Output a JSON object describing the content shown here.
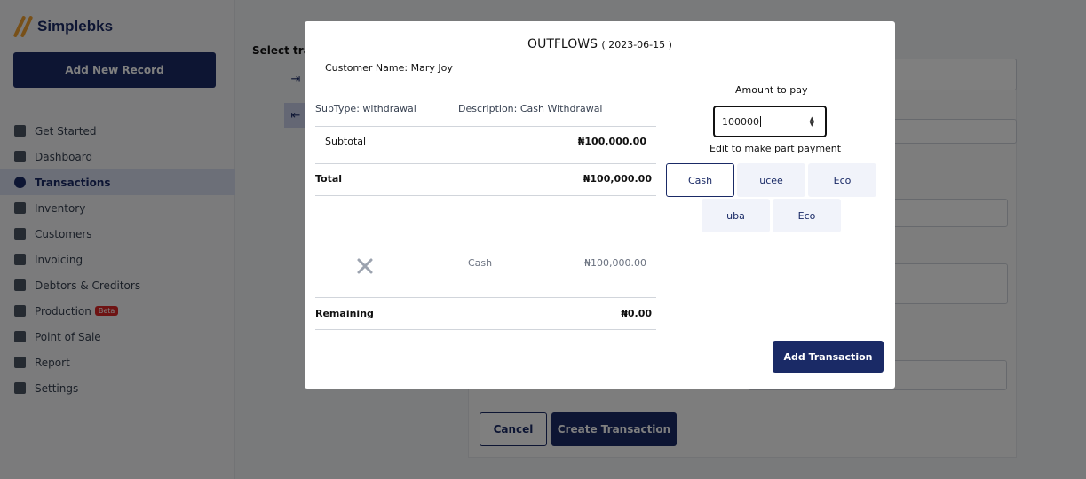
{
  "brand": {
    "name": "Simplebks"
  },
  "sidebar": {
    "add_record": "Add New Record",
    "items": [
      {
        "label": "Get Started",
        "icon": "layers-icon"
      },
      {
        "label": "Dashboard",
        "icon": "grid-icon"
      },
      {
        "label": "Transactions",
        "icon": "clock-icon",
        "active": true
      },
      {
        "label": "Inventory",
        "icon": "bag-icon"
      },
      {
        "label": "Customers",
        "icon": "person-icon"
      },
      {
        "label": "Invoicing",
        "icon": "document-icon"
      },
      {
        "label": "Debtors & Creditors",
        "icon": "scale-icon"
      },
      {
        "label": "Production",
        "icon": "factory-icon",
        "badge": "Beta"
      },
      {
        "label": "Point of Sale",
        "icon": "register-icon"
      },
      {
        "label": "Report",
        "icon": "chart-icon"
      },
      {
        "label": "Settings",
        "icon": "gear-icon"
      }
    ]
  },
  "main": {
    "select_label": "Select tran",
    "cancel": "Cancel",
    "create": "Create Transaction"
  },
  "modal": {
    "title": "OUTFLOWS",
    "date": "( 2023-06-15 )",
    "customer": "Customer Name: Mary Joy",
    "subtype": "SubType: withdrawal",
    "description": "Description: Cash Withdrawal",
    "subtotal_label": "Subtotal",
    "subtotal_value": "₦100,000.00",
    "total_label": "Total",
    "total_value": "₦100,000.00",
    "payment_method": "Cash",
    "payment_amount": "₦100,000.00",
    "remaining_label": "Remaining",
    "remaining_value": "₦0.00",
    "amount_label": "Amount to pay",
    "amount_value": "100000",
    "edit_hint": "Edit to make part payment",
    "methods": [
      "Cash",
      "ucee",
      "Eco",
      "uba",
      "Eco"
    ],
    "add_button": "Add Transaction"
  },
  "colors": {
    "primary": "#1a2a66",
    "brand_accent": "#f0a030",
    "beta": "#dc2626"
  }
}
